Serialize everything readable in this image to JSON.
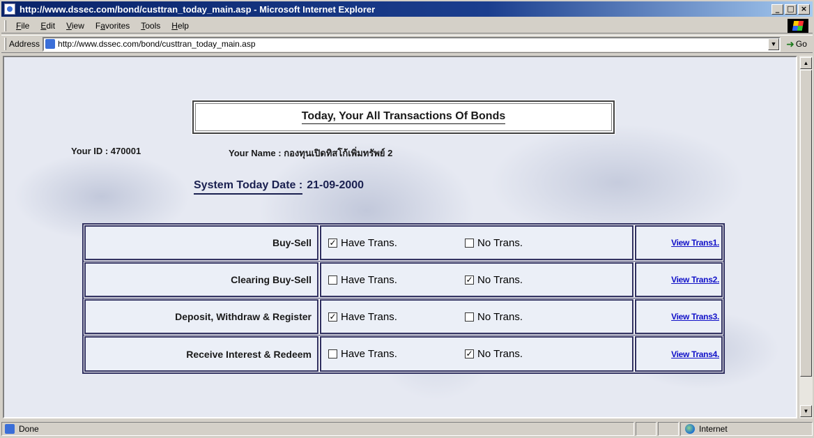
{
  "window": {
    "title": "http://www.dssec.com/bond/custtran_today_main.asp - Microsoft Internet Explorer",
    "buttons": {
      "minimize": "_",
      "maximize": "□",
      "close": "×"
    }
  },
  "menu": {
    "items": [
      {
        "underline": "F",
        "rest": "ile"
      },
      {
        "underline": "E",
        "rest": "dit"
      },
      {
        "underline": "V",
        "rest": "iew"
      },
      {
        "prefix": "F",
        "underline": "a",
        "rest": "vorites"
      },
      {
        "underline": "T",
        "rest": "ools"
      },
      {
        "underline": "H",
        "rest": "elp"
      }
    ]
  },
  "address": {
    "label": "Address",
    "url": "http://www.dssec.com/bond/custtran_today_main.asp",
    "go_label": "Go"
  },
  "page": {
    "heading": "Today, Your All Transactions Of Bonds",
    "your_id": "Your ID : 470001",
    "your_name": "Your Name : กองทุนเปิดทิสโก้เพิ่มทรัพย์ 2",
    "date_label": "System Today Date :",
    "date_value": "21-09-2000",
    "option_have": "Have Trans.",
    "option_no": "No Trans.",
    "rows": [
      {
        "label": "Buy-Sell",
        "have": true,
        "no": false,
        "link": "View Trans1."
      },
      {
        "label": "Clearing Buy-Sell",
        "have": false,
        "no": true,
        "link": "View Trans2."
      },
      {
        "label": "Deposit, Withdraw & Register",
        "have": true,
        "no": false,
        "link": "View Trans3."
      },
      {
        "label": "Receive Interest & Redeem",
        "have": false,
        "no": true,
        "link": "View Trans4."
      }
    ]
  },
  "status": {
    "text": "Done",
    "zone": "Internet"
  }
}
